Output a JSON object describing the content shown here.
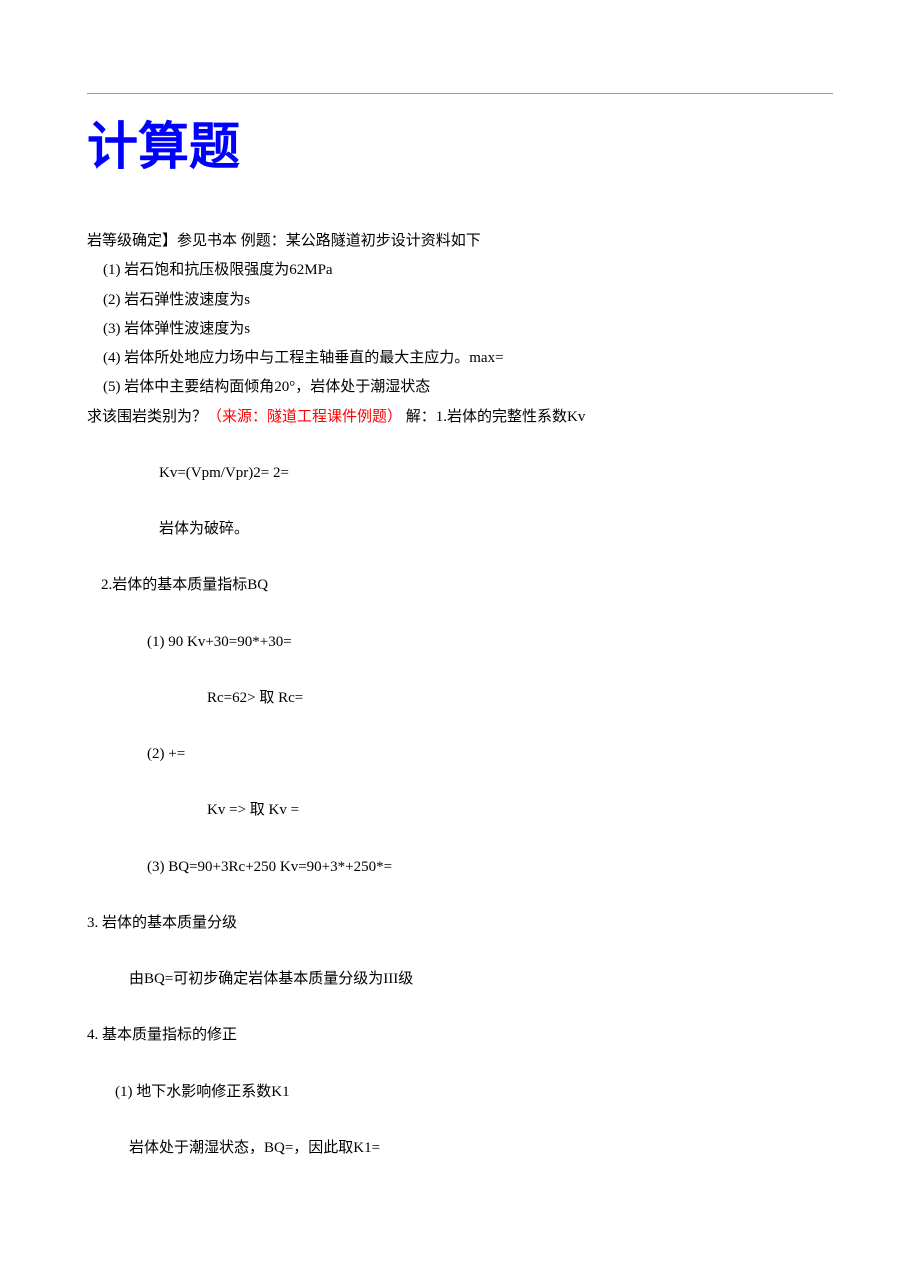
{
  "title": "计算题",
  "intro": "岩等级确定】参见书本 例题：某公路隧道初步设计资料如下",
  "items": [
    "(1)  岩石饱和抗压极限强度为62MPa",
    "(2)  岩石弹性波速度为s",
    "(3)  岩体弹性波速度为s",
    "(4)  岩体所处地应力场中与工程主轴垂直的最大主应力。max=",
    "(5)  岩体中主要结构面倾角20°，岩体处于潮湿状态"
  ],
  "question_prefix": "求该围岩类别为？",
  "source_label": "（来源：隧道工程课件例题）",
  "solution_start": " 解：1.岩体的完整性系数Kv",
  "kv_formula": "Kv=(Vpm/Vpr)2= 2=",
  "kv_conclusion": "岩体为破碎。",
  "sec2_title": "2.岩体的基本质量指标BQ",
  "sec2_item1": "(1)    90 Kv+30=90*+30=",
  "sec2_item1_note": "Rc=62> 取 Rc=",
  "sec2_item2": "(2)    +=",
  "sec2_item2_note": "Kv => 取 Kv =",
  "sec2_item3": "(3)    BQ=90+3Rc+250 Kv=90+3*+250*=",
  "sec3_title": "3. 岩体的基本质量分级",
  "sec3_body": "由BQ=可初步确定岩体基本质量分级为III级",
  "sec4_title": "4. 基本质量指标的修正",
  "sec4_item1": "(1)    地下水影响修正系数K1",
  "sec4_item1_note": "岩体处于潮湿状态，BQ=，因此取K1="
}
